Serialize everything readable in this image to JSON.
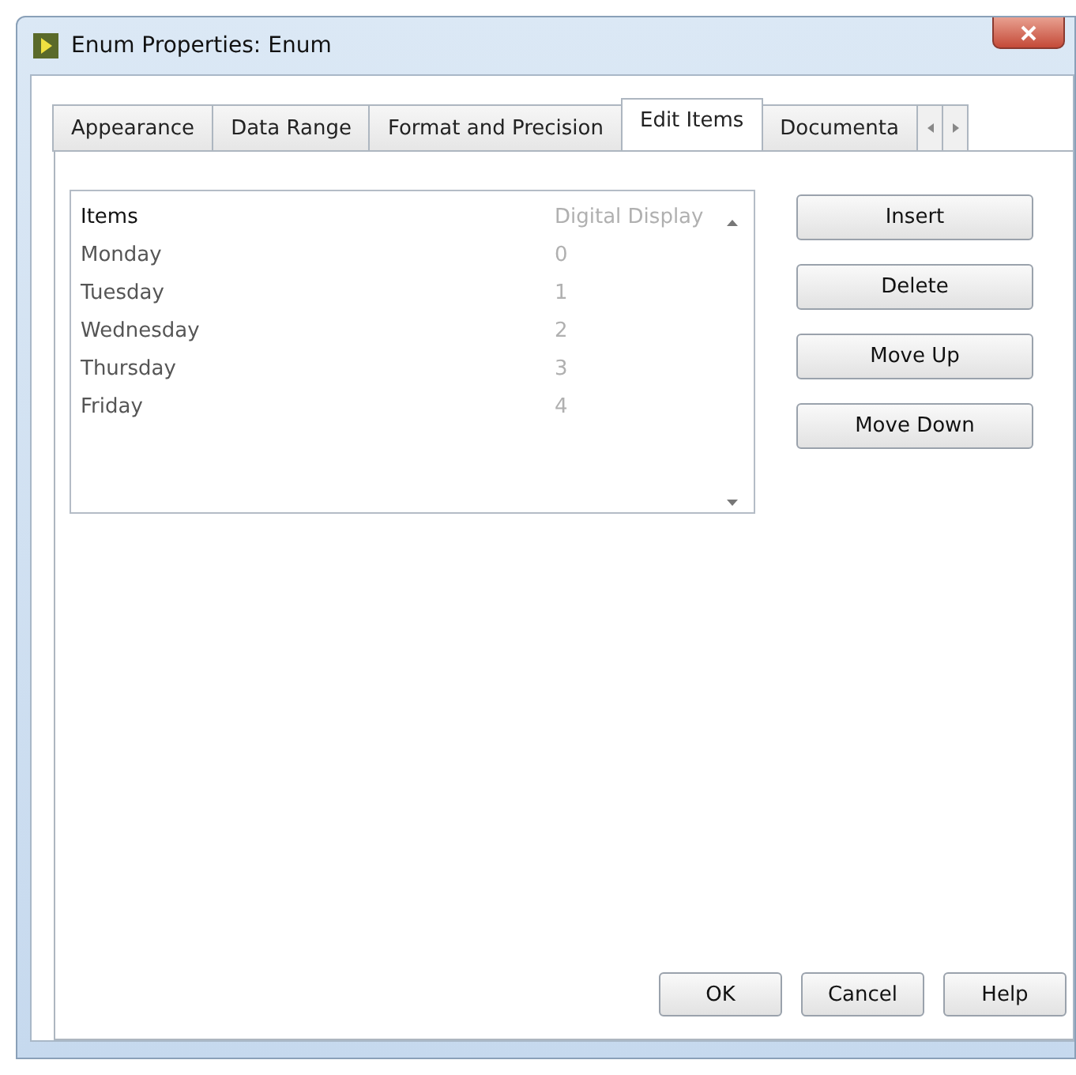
{
  "window": {
    "title": "Enum Properties: Enum"
  },
  "tabs": [
    {
      "label": "Appearance",
      "selected": false
    },
    {
      "label": "Data Range",
      "selected": false
    },
    {
      "label": "Format and Precision",
      "selected": false
    },
    {
      "label": "Edit Items",
      "selected": true
    },
    {
      "label": "Documenta",
      "selected": false
    }
  ],
  "items_table": {
    "columns": [
      "Items",
      "Digital Display"
    ],
    "rows": [
      {
        "item": "Monday",
        "value": "0"
      },
      {
        "item": "Tuesday",
        "value": "1"
      },
      {
        "item": "Wednesday",
        "value": "2"
      },
      {
        "item": "Thursday",
        "value": "3"
      },
      {
        "item": "Friday",
        "value": "4"
      }
    ]
  },
  "side_buttons": [
    "Insert",
    "Delete",
    "Move Up",
    "Move Down"
  ],
  "footer_buttons": [
    "OK",
    "Cancel",
    "Help"
  ]
}
